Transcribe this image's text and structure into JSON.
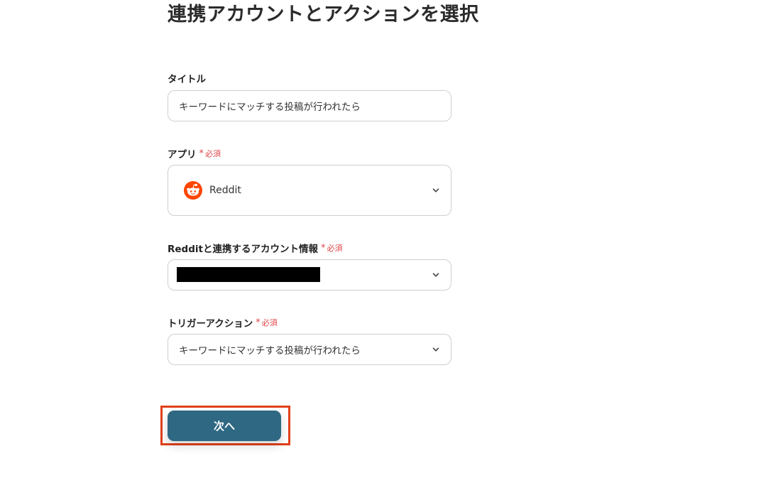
{
  "page": {
    "title": "連携アカウントとアクションを選択"
  },
  "form": {
    "title_field": {
      "label": "タイトル",
      "value": "キーワードにマッチする投稿が行われたら"
    },
    "app_field": {
      "label": "アプリ",
      "required_mark": "*",
      "required_text": "必須",
      "value": "Reddit",
      "icon": "reddit-icon"
    },
    "account_field": {
      "label": "Redditと連携するアカウント情報",
      "required_mark": "*",
      "required_text": "必須"
    },
    "trigger_field": {
      "label": "トリガーアクション",
      "required_mark": "*",
      "required_text": "必須",
      "value": "キーワードにマッチする投稿が行われたら"
    }
  },
  "actions": {
    "next_label": "次へ"
  },
  "colors": {
    "primary_button": "#2e6883",
    "required": "#e0464a",
    "highlight": "#e2401c",
    "reddit_orange": "#ff4500"
  }
}
